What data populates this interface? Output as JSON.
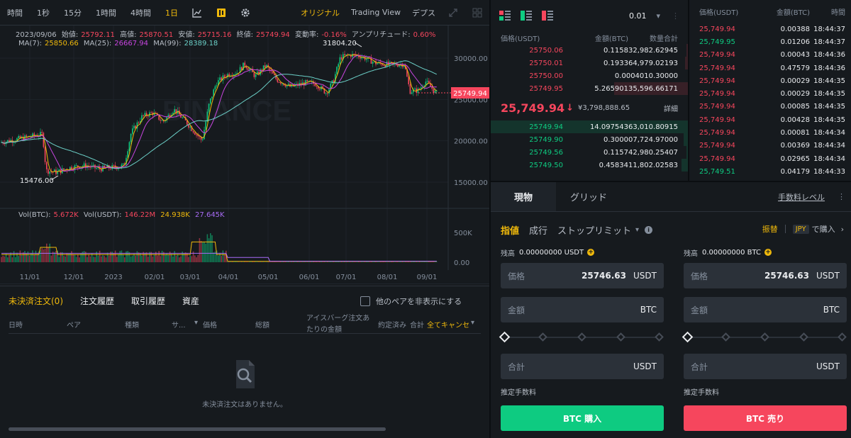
{
  "toolbar": {
    "intervals": [
      "時間",
      "1秒",
      "15分",
      "1時間",
      "4時間",
      "1日"
    ],
    "active_interval": "1日",
    "views": [
      "オリジナル",
      "Trading View",
      "デプス"
    ],
    "active_view": "オリジナル"
  },
  "chart": {
    "ohlc_line": {
      "date": "2023/09/06",
      "open_label": "始値:",
      "open": "25792.11",
      "high_label": "高値:",
      "high": "25870.51",
      "low_label": "安値:",
      "low": "25715.16",
      "close_label": "終値:",
      "close": "25749.94",
      "change_label": "変動率:",
      "change": "-0.16%",
      "amplitude_label": "アンプリチュード:",
      "amplitude": "0.60%"
    },
    "ma_line": {
      "ma7_label": "MA(7):",
      "ma7": "25850.66",
      "ma25_label": "MA(25):",
      "ma25": "26667.94",
      "ma99_label": "MA(99):",
      "ma99": "28389.18"
    },
    "vol_line": {
      "vol_btc_label": "Vol(BTC):",
      "vol_btc": "5.672K",
      "vol_usdt_label": "Vol(USDT):",
      "vol_usdt": "146.22M",
      "v2": "24.938K",
      "v3": "27.645K"
    },
    "price_axis": [
      "30000.00",
      "25000.00",
      "20000.00",
      "15000.00"
    ],
    "current_price_tag": "25749.94",
    "high_marker": "31804.20",
    "low_marker": "15476.00",
    "volume_axis": [
      "500K",
      "0.00"
    ],
    "date_axis": [
      "11/01",
      "12/01",
      "2023",
      "02/01",
      "03/01",
      "04/01",
      "05/01",
      "06/01",
      "07/01",
      "08/01",
      "09/01"
    ],
    "watermark": "BINANCE"
  },
  "orders": {
    "tabs": [
      "未決済注文(0)",
      "注文履歴",
      "取引履歴",
      "資産"
    ],
    "active_tab": "未決済注文(0)",
    "hide_other_pairs": "他のペアを非表示にする",
    "columns": {
      "date": "日時",
      "pair": "ペア",
      "type": "種類",
      "side": "サ...",
      "price": "価格",
      "amount": "総額",
      "iceberg": "アイスバーグ注文あ",
      "iceberg2": "たりの金額",
      "filled": "約定済み",
      "total": "合計",
      "cancel_all": "全てキャンセ"
    },
    "empty_text": "未決済注文はありません。"
  },
  "orderbook": {
    "tick_size": "0.01",
    "headers": [
      "価格(USDT)",
      "金額(BTC)",
      "数量合計"
    ],
    "asks": [
      {
        "price": "25750.06",
        "amount": "0.11583",
        "total": "2,982.62945"
      },
      {
        "price": "25750.01",
        "amount": "0.19336",
        "total": "4,979.02193"
      },
      {
        "price": "25750.00",
        "amount": "0.00040",
        "total": "10.30000"
      },
      {
        "price": "25749.95",
        "amount": "5.26590",
        "total": "135,596.66171"
      }
    ],
    "mid_price": "25,749.94",
    "mid_arrow": "↓",
    "mid_fiat": "¥3,798,888.65",
    "more": "詳細",
    "bids": [
      {
        "price": "25749.94",
        "amount": "14.09754",
        "total": "363,010.80915"
      },
      {
        "price": "25749.90",
        "amount": "0.30000",
        "total": "7,724.97000"
      },
      {
        "price": "25749.56",
        "amount": "0.11574",
        "total": "2,980.25407"
      },
      {
        "price": "25749.50",
        "amount": "0.45834",
        "total": "11,802.02583"
      }
    ]
  },
  "trades": {
    "headers": [
      "価格(USDT)",
      "金額(BTC)",
      "時間"
    ],
    "rows": [
      {
        "price": "25,749.94",
        "amount": "0.00388",
        "time": "18:44:37",
        "side": "down"
      },
      {
        "price": "25,749.95",
        "amount": "0.01206",
        "time": "18:44:37",
        "side": "up"
      },
      {
        "price": "25,749.94",
        "amount": "0.00043",
        "time": "18:44:36",
        "side": "down"
      },
      {
        "price": "25,749.94",
        "amount": "0.47579",
        "time": "18:44:36",
        "side": "down"
      },
      {
        "price": "25,749.94",
        "amount": "0.00029",
        "time": "18:44:35",
        "side": "down"
      },
      {
        "price": "25,749.94",
        "amount": "0.00029",
        "time": "18:44:35",
        "side": "down"
      },
      {
        "price": "25,749.94",
        "amount": "0.00085",
        "time": "18:44:35",
        "side": "down"
      },
      {
        "price": "25,749.94",
        "amount": "0.00428",
        "time": "18:44:35",
        "side": "down"
      },
      {
        "price": "25,749.94",
        "amount": "0.00081",
        "time": "18:44:34",
        "side": "down"
      },
      {
        "price": "25,749.94",
        "amount": "0.00369",
        "time": "18:44:34",
        "side": "down"
      },
      {
        "price": "25,749.94",
        "amount": "0.02965",
        "time": "18:44:34",
        "side": "down"
      },
      {
        "price": "25,749.51",
        "amount": "0.04179",
        "time": "18:44:33",
        "side": "up"
      }
    ]
  },
  "form": {
    "tabs": [
      "現物",
      "グリッド"
    ],
    "active_tab": "現物",
    "fee_level": "手数料レベル",
    "order_types": [
      "指値",
      "成行",
      "ストップリミット"
    ],
    "active_order_type": "指値",
    "margin": "振替",
    "currency_badge": "JPY",
    "buy_in": "で購入",
    "buy": {
      "balance_label": "残高",
      "balance": "0.00000000 USDT",
      "price_label": "価格",
      "price": "25746.63",
      "price_unit": "USDT",
      "amount_label": "金額",
      "amount_unit": "BTC",
      "total_label": "合計",
      "total_unit": "USDT",
      "fee_label": "推定手数料",
      "button": "BTC 購入"
    },
    "sell": {
      "balance_label": "残高",
      "balance": "0.00000000 BTC",
      "price_label": "価格",
      "price": "25746.63",
      "price_unit": "USDT",
      "amount_label": "金額",
      "amount_unit": "BTC",
      "total_label": "合計",
      "total_unit": "USDT",
      "fee_label": "推定手数料",
      "button": "BTC 売り"
    }
  },
  "colors": {
    "up": "#0ecb81",
    "down": "#f6465d",
    "accent": "#f0b90b",
    "bg": "#161a1e"
  }
}
